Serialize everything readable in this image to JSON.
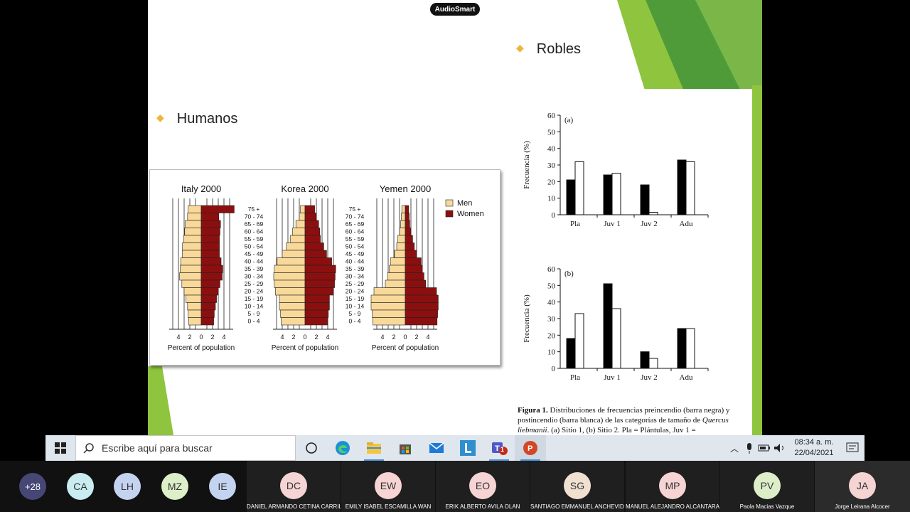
{
  "overlay": {
    "audiosmart_label": "AudioSmart"
  },
  "slide": {
    "bullet_robles": "Robles",
    "bullet_humanos": "Humanos"
  },
  "pyramids": {
    "age_groups": [
      "75 +",
      "70 - 74",
      "65 - 69",
      "60 - 64",
      "55 - 59",
      "50 - 54",
      "45 - 49",
      "40 - 44",
      "35 - 39",
      "30 - 34",
      "25 - 29",
      "20 - 24",
      "15 - 19",
      "10 - 14",
      "5 - 9",
      "0 - 4"
    ],
    "legend": {
      "men": "Men",
      "women": "Women"
    },
    "men_color": "#f9d99a",
    "women_color": "#8c0f0f",
    "xlabel": "Percent of population",
    "ticks": [
      "4",
      "2",
      "0",
      "2",
      "4"
    ],
    "countries": [
      {
        "title": "Italy 2000",
        "men": [
          2.3,
          2.4,
          2.8,
          2.9,
          3.1,
          3.3,
          3.3,
          3.6,
          3.7,
          3.8,
          3.4,
          3.0,
          2.7,
          2.4,
          2.3,
          2.2
        ],
        "women": [
          5.8,
          3.1,
          3.4,
          3.3,
          3.2,
          3.2,
          3.2,
          3.5,
          3.8,
          3.7,
          3.3,
          3.0,
          2.7,
          2.5,
          2.3,
          2.2
        ]
      },
      {
        "title": "Korea 2000",
        "men": [
          0.8,
          1.0,
          1.6,
          2.2,
          2.6,
          3.3,
          4.0,
          4.9,
          5.4,
          5.5,
          5.4,
          5.2,
          4.5,
          4.5,
          4.3,
          4.2
        ],
        "women": [
          1.7,
          2.0,
          2.4,
          2.6,
          2.7,
          3.3,
          3.8,
          4.7,
          5.4,
          5.3,
          5.2,
          5.0,
          4.3,
          4.3,
          4.1,
          4.0
        ]
      },
      {
        "title": "Yemen 2000",
        "men": [
          0.6,
          0.7,
          0.8,
          1.0,
          1.3,
          1.5,
          1.9,
          2.6,
          2.8,
          3.1,
          3.5,
          5.5,
          6.0,
          6.0,
          5.8,
          5.7
        ],
        "women": [
          0.6,
          0.7,
          0.8,
          1.0,
          1.3,
          1.6,
          2.0,
          2.8,
          3.0,
          3.3,
          3.6,
          5.5,
          5.8,
          5.8,
          5.7,
          5.6
        ]
      }
    ]
  },
  "chart_data": [
    {
      "type": "bar",
      "title": "(a)",
      "ylabel": "Frecuencia (%)",
      "ylim": [
        0,
        60
      ],
      "yticks": [
        "0",
        "10",
        "20",
        "30",
        "40",
        "50",
        "60"
      ],
      "categories": [
        "Pla",
        "Juv 1",
        "Juv 2",
        "Adu"
      ],
      "series": [
        {
          "values": [
            21,
            24,
            18,
            33
          ],
          "color": "#000000"
        },
        {
          "values": [
            32,
            25,
            1.5,
            32
          ],
          "color": "#ffffff"
        }
      ]
    },
    {
      "type": "bar",
      "title": "(b)",
      "ylabel": "Frecuencia (%)",
      "ylim": [
        0,
        60
      ],
      "yticks": [
        "0",
        "10",
        "20",
        "30",
        "40",
        "50",
        "60"
      ],
      "categories": [
        "Pla",
        "Juv 1",
        "Juv 2",
        "Adu"
      ],
      "series": [
        {
          "values": [
            18,
            51,
            10,
            24
          ],
          "color": "#000000"
        },
        {
          "values": [
            33,
            36,
            6,
            24
          ],
          "color": "#ffffff"
        }
      ]
    }
  ],
  "caption": {
    "lead": "Figura 1.",
    "text": " Distribuciones de frecuencias preincendio (barra negra) y postincendio (barra blanca) de las categorías de tamaño de ",
    "species": "Quercus liebmanii",
    "tail": ". (a) Sitio 1, (b) Sitio 2. Pla = Plántulas, Juv 1 ="
  },
  "taskbar": {
    "search_placeholder": "Escribe aquí para buscar",
    "apps": [
      "task-view-icon",
      "edge-icon",
      "file-explorer-icon",
      "store-icon",
      "mail-icon",
      "l-app-icon",
      "teams-icon",
      "powerpoint-icon"
    ],
    "teams_badge": "1",
    "time": "08:34 a. m.",
    "date": "22/04/2021"
  },
  "participants": {
    "extra_count": "+28",
    "small": [
      {
        "initials": "CA",
        "color": "#c9ecf0"
      },
      {
        "initials": "LH",
        "color": "#c4d3f0"
      },
      {
        "initials": "MZ",
        "color": "#dcefc8"
      },
      {
        "initials": "IE",
        "color": "#c4d3f0"
      }
    ],
    "tiles": [
      {
        "initials": "DC",
        "name": "DANIEL ARMANDO CETINA CARRIL...",
        "color": "#f7d4d4"
      },
      {
        "initials": "EW",
        "name": "EMILY ISABEL ESCAMILLA WAN",
        "color": "#f7d4d4"
      },
      {
        "initials": "EO",
        "name": "ERIK ALBERTO AVILA OLAN",
        "color": "#f7d4d4"
      },
      {
        "initials": "SG",
        "name": "SANTIAGO EMMANUEL ANCHEVID...",
        "color": "#f0e0d0"
      },
      {
        "initials": "MP",
        "name": "MANUEL ALEJANDRO ALCANTARA...",
        "color": "#f7d4d4"
      },
      {
        "initials": "PV",
        "name": "Paola  Macias Vazque",
        "color": "#dcefc8"
      },
      {
        "initials": "JA",
        "name": "Jorge Leirana Alcocer",
        "color": "#f7d4d4"
      }
    ]
  }
}
